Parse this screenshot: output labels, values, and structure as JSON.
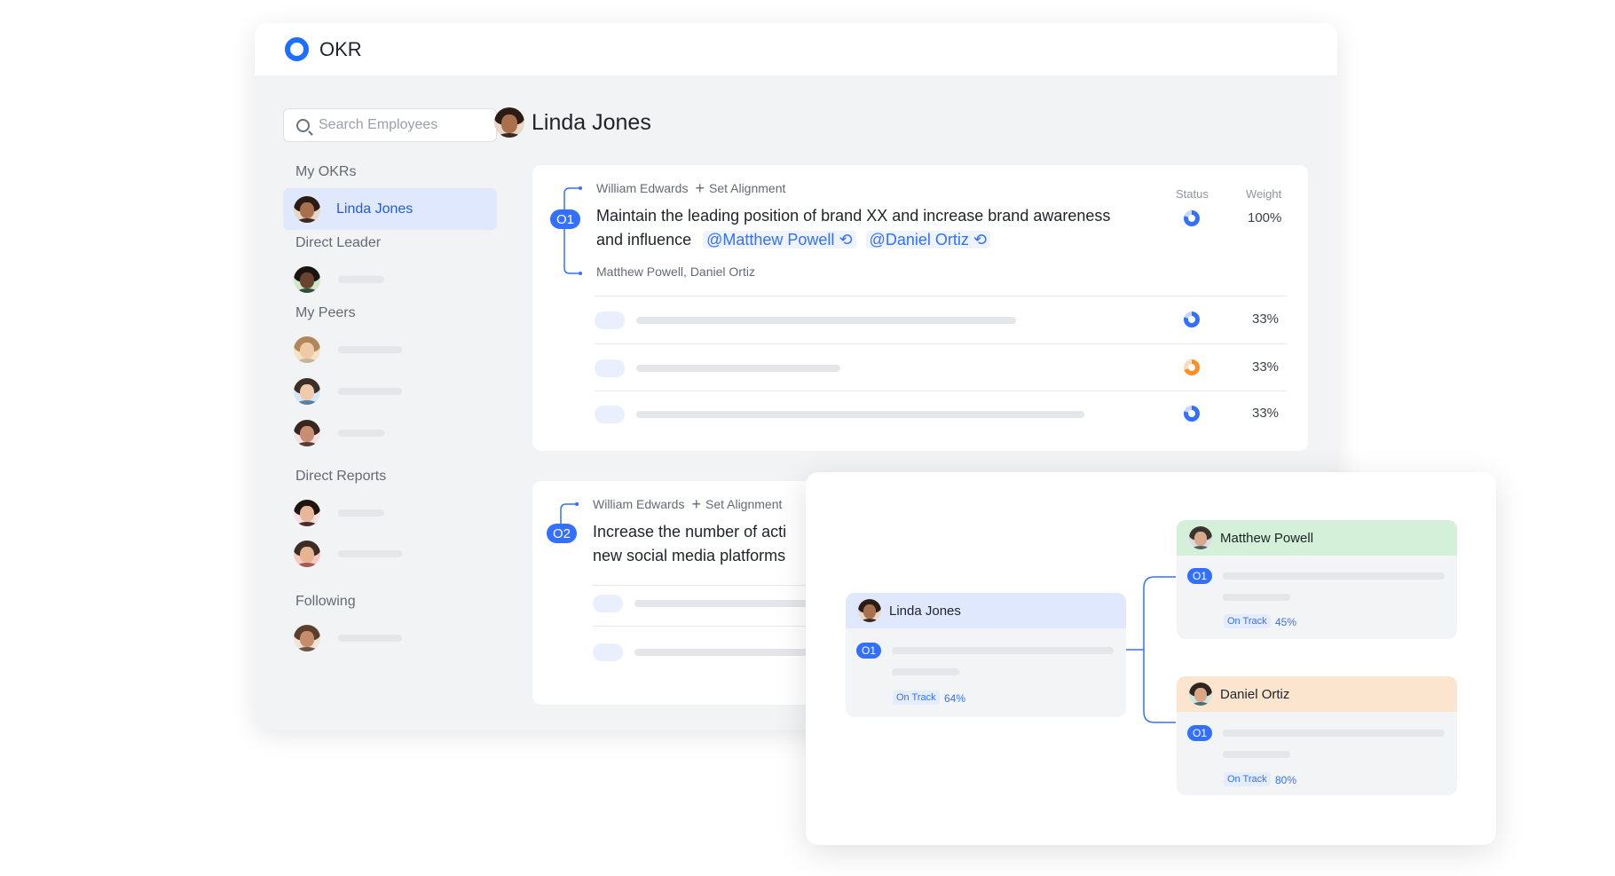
{
  "app": {
    "title": "OKR"
  },
  "sidebar": {
    "search_placeholder": "Search Employees",
    "my_okrs_label": "My OKRs",
    "current_user": "Linda Jones",
    "direct_leader_label": "Direct Leader",
    "my_peers_label": "My Peers",
    "direct_reports_label": "Direct Reports",
    "following_label": "Following"
  },
  "main": {
    "person_name": "Linda Jones",
    "status_header": "Status",
    "weight_header": "Weight",
    "objectives": [
      {
        "badge": "O1",
        "owner": "William Edwards",
        "set_alignment": "Set Alignment",
        "text_line1": "Maintain the leading position of brand XX and increase brand awareness",
        "text_line2": "and influence",
        "mention1": "@Matthew Powell",
        "mention2": "@Daniel Ortiz",
        "aligned": "Matthew Powell, Daniel Ortiz",
        "weight": "100%",
        "key_results": [
          {
            "weight": "33%",
            "status": "blue"
          },
          {
            "weight": "33%",
            "status": "orange"
          },
          {
            "weight": "33%",
            "status": "blue"
          }
        ]
      },
      {
        "badge": "O2",
        "owner": "William Edwards",
        "set_alignment": "Set Alignment",
        "text_line1": "Increase the number of acti",
        "text_line2": "new social media platforms"
      }
    ]
  },
  "alignment": {
    "root": {
      "name": "Linda Jones",
      "badge": "O1",
      "status": "On Track",
      "progress": "64%"
    },
    "children": [
      {
        "name": "Matthew Powell",
        "badge": "O1",
        "status": "On Track",
        "progress": "45%",
        "color": "#d5f0d8"
      },
      {
        "name": "Daniel Ortiz",
        "badge": "O1",
        "status": "On Track",
        "progress": "80%",
        "color": "#fbe5cf"
      }
    ]
  },
  "colors": {
    "accent": "#3370ff",
    "status_warning": "#ff8f1f"
  }
}
